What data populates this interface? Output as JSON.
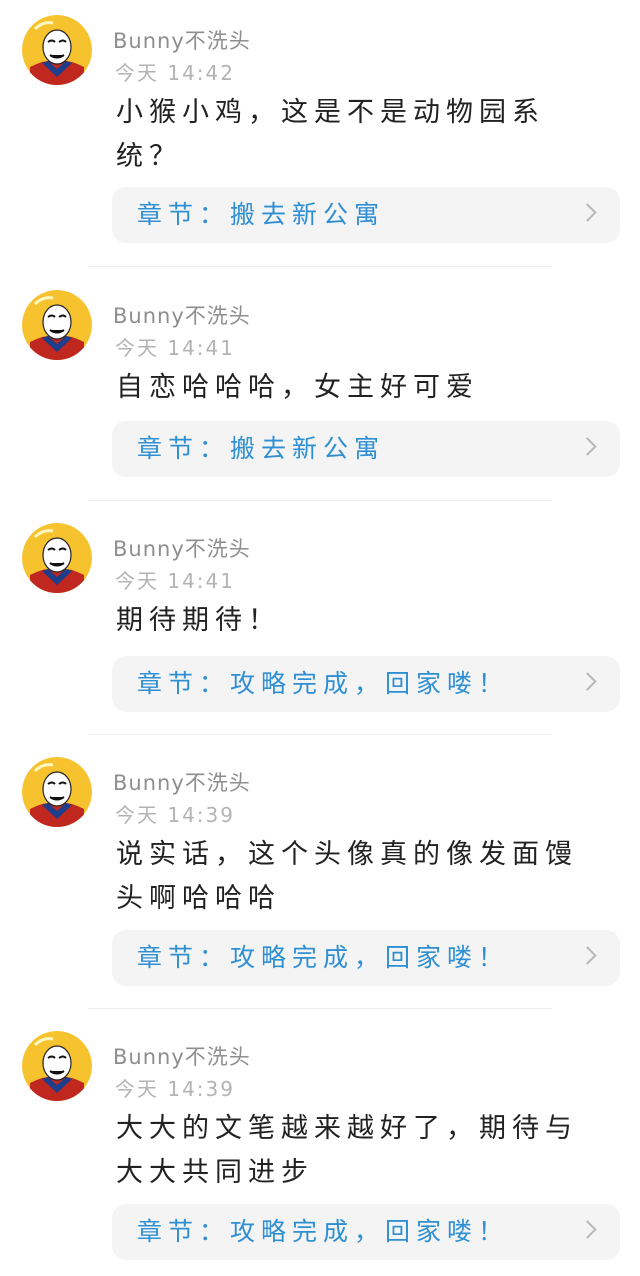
{
  "comments": [
    {
      "username": "Bunny不洗头",
      "time": "今天 14:42",
      "content": "小猴小鸡，这是不是动物园系统？",
      "chapter": "章节：搬去新公寓"
    },
    {
      "username": "Bunny不洗头",
      "time": "今天 14:41",
      "content": "自恋哈哈哈，女主好可爱",
      "chapter": "章节：搬去新公寓"
    },
    {
      "username": "Bunny不洗头",
      "time": "今天 14:41",
      "content": "期待期待！",
      "chapter": "章节：攻略完成，回家喽！"
    },
    {
      "username": "Bunny不洗头",
      "time": "今天 14:39",
      "content": "说实话，这个头像真的像发面馒头啊哈哈哈",
      "chapter": "章节：攻略完成，回家喽！"
    },
    {
      "username": "Bunny不洗头",
      "time": "今天 14:39",
      "content": "大大的文笔越来越好了，期待与大大共同进步",
      "chapter": "章节：攻略完成，回家喽！"
    }
  ],
  "icons": {
    "chevron": "chevron-right-icon",
    "avatar": "avatar"
  },
  "colors": {
    "chapter_link": "#2f8fd3",
    "chapter_bg": "#f4f4f4",
    "username": "#8e8e8e",
    "timestamp": "#b3b3b3",
    "content": "#222222"
  }
}
